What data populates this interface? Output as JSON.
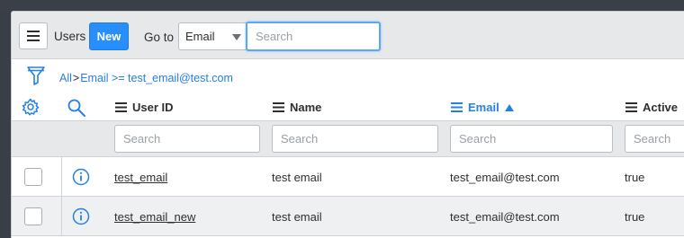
{
  "toolbar": {
    "list_title": "Users",
    "new_label": "New",
    "goto_label": "Go to",
    "goto_field": "Email",
    "search_placeholder": "Search"
  },
  "breadcrumb": {
    "all": "All",
    "separator": ">",
    "condition": "Email >= test_email@test.com"
  },
  "columns": [
    {
      "label": "User ID",
      "sorted": false
    },
    {
      "label": "Name",
      "sorted": false
    },
    {
      "label": "Email",
      "sorted": true,
      "sort_direction": "ascending"
    },
    {
      "label": "Active",
      "sorted": false
    }
  ],
  "column_search_placeholder": "Search",
  "rows": [
    {
      "user_id": "test_email",
      "name": "test email",
      "email": "test_email@test.com",
      "active": "true"
    },
    {
      "user_id": "test_email_new",
      "name": "test email",
      "email": "test_email@test.com",
      "active": "true"
    }
  ],
  "colors": {
    "accent": "#278efc",
    "link": "#2580e3",
    "toolbar_bg": "#e6e8ea",
    "frame_bg": "#3a3f47"
  },
  "icons": [
    "hamburger-menu-icon",
    "funnel-filter-icon",
    "gear-icon",
    "magnifier-icon",
    "column-menu-icon",
    "sort-up-icon",
    "info-icon"
  ]
}
